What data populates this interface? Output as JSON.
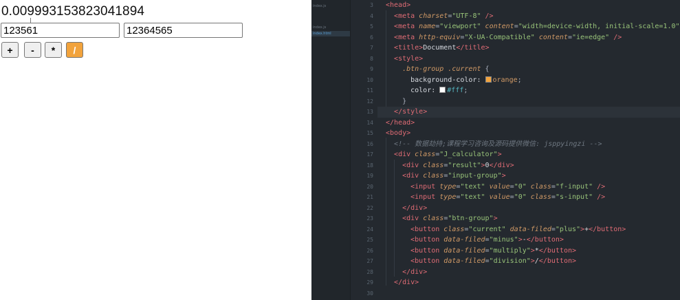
{
  "preview": {
    "result": "0.009993153823041894",
    "first_input": "123561",
    "second_input": "12364565",
    "buttons": [
      "+",
      "-",
      "*",
      "/"
    ],
    "active_button_color": "#f2a33c"
  },
  "editor": {
    "file_tree": [
      {
        "label": "index.js",
        "active": false
      },
      {
        "label": "",
        "active": false
      },
      {
        "label": "index.js",
        "active": false
      },
      {
        "label": "index.html",
        "active": true
      }
    ],
    "line_numbers": [
      3,
      4,
      5,
      6,
      7,
      8,
      9,
      10,
      11,
      12,
      13,
      14,
      15,
      16,
      17,
      18,
      19,
      20,
      21,
      22,
      23,
      24,
      25,
      26,
      27,
      28,
      29,
      30
    ],
    "current_line": 13,
    "code_lines": [
      [
        [
          "tg",
          "<head>"
        ]
      ],
      [
        [
          "pu",
          "  "
        ],
        [
          "tg",
          "<meta "
        ],
        [
          "at",
          "charset"
        ],
        [
          "pu",
          "="
        ],
        [
          "st",
          "\"UTF-8\""
        ],
        [
          "tg",
          " />"
        ]
      ],
      [
        [
          "pu",
          "  "
        ],
        [
          "tg",
          "<meta "
        ],
        [
          "at",
          "name"
        ],
        [
          "pu",
          "="
        ],
        [
          "st",
          "\"viewport\""
        ],
        [
          "pu",
          " "
        ],
        [
          "at",
          "content"
        ],
        [
          "pu",
          "="
        ],
        [
          "st",
          "\"width=device-width, initial-scale=1.0\""
        ]
      ],
      [
        [
          "pu",
          "  "
        ],
        [
          "tg",
          "<meta "
        ],
        [
          "at",
          "http-equiv"
        ],
        [
          "pu",
          "="
        ],
        [
          "st",
          "\"X-UA-Compatible\""
        ],
        [
          "pu",
          " "
        ],
        [
          "at",
          "content"
        ],
        [
          "pu",
          "="
        ],
        [
          "st",
          "\"ie=edge\""
        ],
        [
          "tg",
          " />"
        ]
      ],
      [
        [
          "pu",
          "  "
        ],
        [
          "tg",
          "<title>"
        ],
        [
          "tx",
          "Document"
        ],
        [
          "tg",
          "</title>"
        ]
      ],
      [
        [
          "pu",
          "  "
        ],
        [
          "tg",
          "<style>"
        ]
      ],
      [
        [
          "pu",
          "    "
        ],
        [
          "sl",
          ".btn-group .current"
        ],
        [
          "pu",
          " {"
        ]
      ],
      [
        [
          "pu",
          "      "
        ],
        [
          "pr",
          "background-color: "
        ],
        [
          "swatch",
          "#f2a33c"
        ],
        [
          "vl",
          "orange"
        ],
        [
          "pu",
          ";"
        ]
      ],
      [
        [
          "pu",
          "      "
        ],
        [
          "pr",
          "color: "
        ],
        [
          "swatch",
          "#ffffff"
        ],
        [
          "hx",
          "#fff"
        ],
        [
          "pu",
          ";"
        ]
      ],
      [
        [
          "pu",
          "    }"
        ]
      ],
      [
        [
          "pu",
          "  "
        ],
        [
          "tg",
          "</style>"
        ]
      ],
      [
        [
          "tg",
          "</head>"
        ]
      ],
      [
        [
          "tg",
          "<body>"
        ]
      ],
      [
        [
          "pu",
          "  "
        ],
        [
          "cm",
          "<!-- 数据劫持;课程学习咨询及源码提供微信: jsppyingzi -->"
        ]
      ],
      [
        [
          "pu",
          "  "
        ],
        [
          "tg",
          "<div "
        ],
        [
          "at",
          "class"
        ],
        [
          "pu",
          "="
        ],
        [
          "st",
          "\"J_calculator\""
        ],
        [
          "tg",
          ">"
        ]
      ],
      [
        [
          "pu",
          "    "
        ],
        [
          "tg",
          "<div "
        ],
        [
          "at",
          "class"
        ],
        [
          "pu",
          "="
        ],
        [
          "st",
          "\"result\""
        ],
        [
          "tg",
          ">"
        ],
        [
          "tx",
          "0"
        ],
        [
          "tg",
          "</div>"
        ]
      ],
      [
        [
          "pu",
          "    "
        ],
        [
          "tg",
          "<div "
        ],
        [
          "at",
          "class"
        ],
        [
          "pu",
          "="
        ],
        [
          "st",
          "\"input-group\""
        ],
        [
          "tg",
          ">"
        ]
      ],
      [
        [
          "pu",
          "      "
        ],
        [
          "tg",
          "<input "
        ],
        [
          "at",
          "type"
        ],
        [
          "pu",
          "="
        ],
        [
          "st",
          "\"text\""
        ],
        [
          "pu",
          " "
        ],
        [
          "at",
          "value"
        ],
        [
          "pu",
          "="
        ],
        [
          "st",
          "\"0\""
        ],
        [
          "pu",
          " "
        ],
        [
          "at",
          "class"
        ],
        [
          "pu",
          "="
        ],
        [
          "st",
          "\"f-input\""
        ],
        [
          "tg",
          " />"
        ]
      ],
      [
        [
          "pu",
          "      "
        ],
        [
          "tg",
          "<input "
        ],
        [
          "at",
          "type"
        ],
        [
          "pu",
          "="
        ],
        [
          "st",
          "\"text\""
        ],
        [
          "pu",
          " "
        ],
        [
          "at",
          "value"
        ],
        [
          "pu",
          "="
        ],
        [
          "st",
          "\"0\""
        ],
        [
          "pu",
          " "
        ],
        [
          "at",
          "class"
        ],
        [
          "pu",
          "="
        ],
        [
          "st",
          "\"s-input\""
        ],
        [
          "tg",
          " />"
        ]
      ],
      [
        [
          "pu",
          "    "
        ],
        [
          "tg",
          "</div>"
        ]
      ],
      [
        [
          "pu",
          "    "
        ],
        [
          "tg",
          "<div "
        ],
        [
          "at",
          "class"
        ],
        [
          "pu",
          "="
        ],
        [
          "st",
          "\"btn-group\""
        ],
        [
          "tg",
          ">"
        ]
      ],
      [
        [
          "pu",
          "      "
        ],
        [
          "tg",
          "<button "
        ],
        [
          "at",
          "class"
        ],
        [
          "pu",
          "="
        ],
        [
          "st",
          "\"current\""
        ],
        [
          "pu",
          " "
        ],
        [
          "at",
          "data-filed"
        ],
        [
          "pu",
          "="
        ],
        [
          "st",
          "\"plus\""
        ],
        [
          "tg",
          ">"
        ],
        [
          "tx",
          "+"
        ],
        [
          "tg",
          "</button>"
        ]
      ],
      [
        [
          "pu",
          "      "
        ],
        [
          "tg",
          "<button "
        ],
        [
          "at",
          "data-filed"
        ],
        [
          "pu",
          "="
        ],
        [
          "st",
          "\"minus\""
        ],
        [
          "tg",
          ">"
        ],
        [
          "tx",
          "-"
        ],
        [
          "tg",
          "</button>"
        ]
      ],
      [
        [
          "pu",
          "      "
        ],
        [
          "tg",
          "<button "
        ],
        [
          "at",
          "data-filed"
        ],
        [
          "pu",
          "="
        ],
        [
          "st",
          "\"multiply\""
        ],
        [
          "tg",
          ">"
        ],
        [
          "tx",
          "*"
        ],
        [
          "tg",
          "</button>"
        ]
      ],
      [
        [
          "pu",
          "      "
        ],
        [
          "tg",
          "<button "
        ],
        [
          "at",
          "data-filed"
        ],
        [
          "pu",
          "="
        ],
        [
          "st",
          "\"division\""
        ],
        [
          "tg",
          ">"
        ],
        [
          "tx",
          "/"
        ],
        [
          "tg",
          "</button>"
        ]
      ],
      [
        [
          "pu",
          "    "
        ],
        [
          "tg",
          "</div>"
        ]
      ],
      [
        [
          "pu",
          "  "
        ],
        [
          "tg",
          "</div>"
        ]
      ],
      []
    ]
  },
  "colors": {
    "editor_bg": "#24292f",
    "tag": "#e06c75",
    "attribute": "#d19a66",
    "string": "#98c379",
    "comment": "#6e7781"
  }
}
